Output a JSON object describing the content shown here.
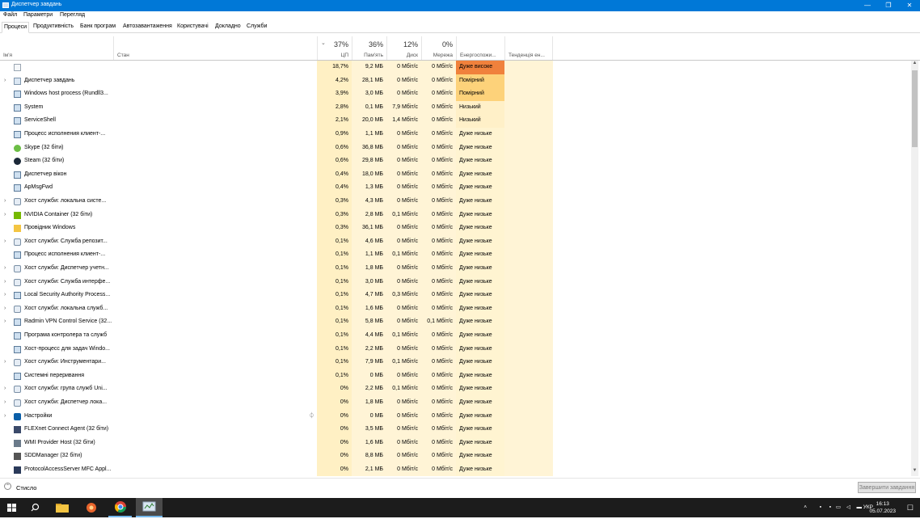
{
  "window": {
    "title": "Диспетчер завдань",
    "minimize": "—",
    "maximize": "❐",
    "close": "✕"
  },
  "menu": {
    "file": "Файл",
    "options": "Параметри",
    "view": "Перегляд"
  },
  "tabs": [
    "Процеси",
    "Продуктивність",
    "Банк програм",
    "Автозавантаження",
    "Користувачі",
    "Докладно",
    "Служби"
  ],
  "columns": {
    "name": "Ім'я",
    "status": "Стан",
    "cpu": {
      "pct": "37%",
      "label": "ЦП"
    },
    "memory": {
      "pct": "36%",
      "label": "Пам'ять"
    },
    "disk": {
      "pct": "12%",
      "label": "Диск"
    },
    "network": {
      "pct": "0%",
      "label": "Мережа"
    },
    "power": "Енергоспожи...",
    "power_trend": "Тенденція ен..."
  },
  "processes": [
    {
      "name": "",
      "exp": "",
      "icon": "blank-app-icon",
      "cpu": "18,7%",
      "mem": "9,2 МБ",
      "disk": "0 Мбіт/с",
      "net": "0 Мбіт/с",
      "power": "Дуже високе",
      "powerLevel": "vhigh"
    },
    {
      "name": "Диспетчер завдань",
      "exp": "›",
      "icon": "task-manager-icon",
      "cpu": "4,2%",
      "mem": "28,1 МБ",
      "disk": "0 Мбіт/с",
      "net": "0 Мбіт/с",
      "power": "Помірний",
      "powerLevel": "mod"
    },
    {
      "name": "Windows host process (Rundll3...",
      "exp": "",
      "icon": "window-app-icon",
      "cpu": "3,9%",
      "mem": "3,0 МБ",
      "disk": "0 Мбіт/с",
      "net": "0 Мбіт/с",
      "power": "Помірний",
      "powerLevel": "mod"
    },
    {
      "name": "System",
      "exp": "",
      "icon": "window-app-icon",
      "cpu": "2,8%",
      "mem": "0,1 МБ",
      "disk": "7,9 Мбіт/с",
      "net": "0 Мбіт/с",
      "power": "Низький",
      "powerLevel": "low"
    },
    {
      "name": "ServiceShell",
      "exp": "",
      "icon": "window-app-icon",
      "cpu": "2,1%",
      "mem": "20,0 МБ",
      "disk": "1,4 Мбіт/с",
      "net": "0 Мбіт/с",
      "power": "Низький",
      "powerLevel": "low"
    },
    {
      "name": "Процесс исполнения клиент-...",
      "exp": "",
      "icon": "window-app-icon",
      "cpu": "0,9%",
      "mem": "1,1 МБ",
      "disk": "0 Мбіт/с",
      "net": "0 Мбіт/с",
      "power": "Дуже низьке",
      "powerLevel": "vlow"
    },
    {
      "name": "Skype (32 біти)",
      "exp": "",
      "icon": "skype-icon",
      "cpu": "0,6%",
      "mem": "36,8 МБ",
      "disk": "0 Мбіт/с",
      "net": "0 Мбіт/с",
      "power": "Дуже низьке",
      "powerLevel": "vlow"
    },
    {
      "name": "Steam (32 біти)",
      "exp": "",
      "icon": "steam-icon",
      "cpu": "0,6%",
      "mem": "29,8 МБ",
      "disk": "0 Мбіт/с",
      "net": "0 Мбіт/с",
      "power": "Дуже низьке",
      "powerLevel": "vlow"
    },
    {
      "name": "Диспетчер вікон",
      "exp": "",
      "icon": "window-app-icon",
      "cpu": "0,4%",
      "mem": "18,0 МБ",
      "disk": "0 Мбіт/с",
      "net": "0 Мбіт/с",
      "power": "Дуже низьке",
      "powerLevel": "vlow"
    },
    {
      "name": "ApMsgFwd",
      "exp": "",
      "icon": "window-app-icon",
      "cpu": "0,4%",
      "mem": "1,3 МБ",
      "disk": "0 Мбіт/с",
      "net": "0 Мбіт/с",
      "power": "Дуже низьке",
      "powerLevel": "vlow"
    },
    {
      "name": "Хост служби: локальна систе...",
      "exp": "›",
      "icon": "gear-service-icon",
      "cpu": "0,3%",
      "mem": "4,3 МБ",
      "disk": "0 Мбіт/с",
      "net": "0 Мбіт/с",
      "power": "Дуже низьке",
      "powerLevel": "vlow"
    },
    {
      "name": "NVIDIA Container (32 біти)",
      "exp": "›",
      "icon": "nvidia-icon",
      "cpu": "0,3%",
      "mem": "2,8 МБ",
      "disk": "0,1 Мбіт/с",
      "net": "0 Мбіт/с",
      "power": "Дуже низьке",
      "powerLevel": "vlow"
    },
    {
      "name": "Провідник Windows",
      "exp": "",
      "icon": "folder-icon",
      "cpu": "0,3%",
      "mem": "36,1 МБ",
      "disk": "0 Мбіт/с",
      "net": "0 Мбіт/с",
      "power": "Дуже низьке",
      "powerLevel": "vlow"
    },
    {
      "name": "Хост служби: Служба репозит...",
      "exp": "›",
      "icon": "gear-service-icon",
      "cpu": "0,1%",
      "mem": "4,6 МБ",
      "disk": "0 Мбіт/с",
      "net": "0 Мбіт/с",
      "power": "Дуже низьке",
      "powerLevel": "vlow"
    },
    {
      "name": "Процесс исполнения клиент-...",
      "exp": "",
      "icon": "window-app-icon",
      "cpu": "0,1%",
      "mem": "1,1 МБ",
      "disk": "0,1 Мбіт/с",
      "net": "0 Мбіт/с",
      "power": "Дуже низьке",
      "powerLevel": "vlow"
    },
    {
      "name": "Хост служби: Диспетчер учетн...",
      "exp": "›",
      "icon": "gear-service-icon",
      "cpu": "0,1%",
      "mem": "1,8 МБ",
      "disk": "0 Мбіт/с",
      "net": "0 Мбіт/с",
      "power": "Дуже низьке",
      "powerLevel": "vlow"
    },
    {
      "name": "Хост служби: Служба интерфе...",
      "exp": "›",
      "icon": "gear-service-icon",
      "cpu": "0,1%",
      "mem": "3,0 МБ",
      "disk": "0 Мбіт/с",
      "net": "0 Мбіт/с",
      "power": "Дуже низьке",
      "powerLevel": "vlow"
    },
    {
      "name": "Local Security Authority Process...",
      "exp": "›",
      "icon": "window-app-icon",
      "cpu": "0,1%",
      "mem": "4,7 МБ",
      "disk": "0,3 Мбіт/с",
      "net": "0 Мбіт/с",
      "power": "Дуже низьке",
      "powerLevel": "vlow"
    },
    {
      "name": "Хост служби: локальна служб...",
      "exp": "›",
      "icon": "gear-service-icon",
      "cpu": "0,1%",
      "mem": "1,6 МБ",
      "disk": "0 Мбіт/с",
      "net": "0 Мбіт/с",
      "power": "Дуже низьке",
      "powerLevel": "vlow"
    },
    {
      "name": "Radmin VPN Control Service (32...",
      "exp": "›",
      "icon": "window-app-icon",
      "cpu": "0,1%",
      "mem": "5,8 МБ",
      "disk": "0 Мбіт/с",
      "net": "0,1 Мбіт/с",
      "power": "Дуже низьке",
      "powerLevel": "vlow"
    },
    {
      "name": "Програма контролера та служб",
      "exp": "",
      "icon": "window-app-icon",
      "cpu": "0,1%",
      "mem": "4,4 МБ",
      "disk": "0,1 Мбіт/с",
      "net": "0 Мбіт/с",
      "power": "Дуже низьке",
      "powerLevel": "vlow"
    },
    {
      "name": "Хост-процесс для задач Windo...",
      "exp": "",
      "icon": "window-app-icon",
      "cpu": "0,1%",
      "mem": "2,2 МБ",
      "disk": "0 Мбіт/с",
      "net": "0 Мбіт/с",
      "power": "Дуже низьке",
      "powerLevel": "vlow"
    },
    {
      "name": "Хост служби: Инструментари...",
      "exp": "›",
      "icon": "gear-service-icon",
      "cpu": "0,1%",
      "mem": "7,9 МБ",
      "disk": "0,1 Мбіт/с",
      "net": "0 Мбіт/с",
      "power": "Дуже низьке",
      "powerLevel": "vlow"
    },
    {
      "name": "Системні переривання",
      "exp": "",
      "icon": "window-app-icon",
      "cpu": "0,1%",
      "mem": "0 МБ",
      "disk": "0 Мбіт/с",
      "net": "0 Мбіт/с",
      "power": "Дуже низьке",
      "powerLevel": "vlow"
    },
    {
      "name": "Хост служби: група служб Uni...",
      "exp": "›",
      "icon": "gear-service-icon",
      "cpu": "0%",
      "mem": "2,2 МБ",
      "disk": "0,1 Мбіт/с",
      "net": "0 Мбіт/с",
      "power": "Дуже низьке",
      "powerLevel": "vlow"
    },
    {
      "name": "Хост служби: Диспетчер лока...",
      "exp": "›",
      "icon": "gear-service-icon",
      "cpu": "0%",
      "mem": "1,8 МБ",
      "disk": "0 Мбіт/с",
      "net": "0 Мбіт/с",
      "power": "Дуже низьке",
      "powerLevel": "vlow"
    },
    {
      "name": "Настройки",
      "exp": "›",
      "icon": "settings-gear-icon",
      "cpu": "0%",
      "mem": "0 МБ",
      "disk": "0 Мбіт/с",
      "net": "0 Мбіт/с",
      "power": "Дуже низьке",
      "powerLevel": "vlow",
      "leaf": true
    },
    {
      "name": "FLEXnet Connect Agent (32 біти)",
      "exp": "",
      "icon": "flexnet-icon",
      "cpu": "0%",
      "mem": "3,5 МБ",
      "disk": "0 Мбіт/с",
      "net": "0 Мбіт/с",
      "power": "Дуже низьке",
      "powerLevel": "vlow"
    },
    {
      "name": "WMI Provider Host (32 біти)",
      "exp": "",
      "icon": "wmi-icon",
      "cpu": "0%",
      "mem": "1,6 МБ",
      "disk": "0 Мбіт/с",
      "net": "0 Мбіт/с",
      "power": "Дуже низьке",
      "powerLevel": "vlow"
    },
    {
      "name": "SDDManager (32 біти)",
      "exp": "",
      "icon": "sdd-icon",
      "cpu": "0%",
      "mem": "8,8 МБ",
      "disk": "0 Мбіт/с",
      "net": "0 Мбіт/с",
      "power": "Дуже низьке",
      "powerLevel": "vlow"
    },
    {
      "name": "ProtocolAccessServer MFC Appl...",
      "exp": "",
      "icon": "protocol-icon",
      "cpu": "0%",
      "mem": "2,1 МБ",
      "disk": "0 Мбіт/с",
      "net": "0 Мбіт/с",
      "power": "Дуже низьке",
      "powerLevel": "vlow"
    }
  ],
  "colors": {
    "vhigh": "#f0813c",
    "mod": "#fdd27a",
    "low": "#fff0c8",
    "vlow": "#fff4d1",
    "cpuCol": "#fff0c4",
    "col": "#fff4d6",
    "accent": "#0078d7"
  },
  "footer": {
    "fewer_details": "Стисло",
    "end_task": "Завершити завдання"
  },
  "taskbar": {
    "lang": "УКР",
    "time": "16:13",
    "date": "05.07.2023"
  }
}
